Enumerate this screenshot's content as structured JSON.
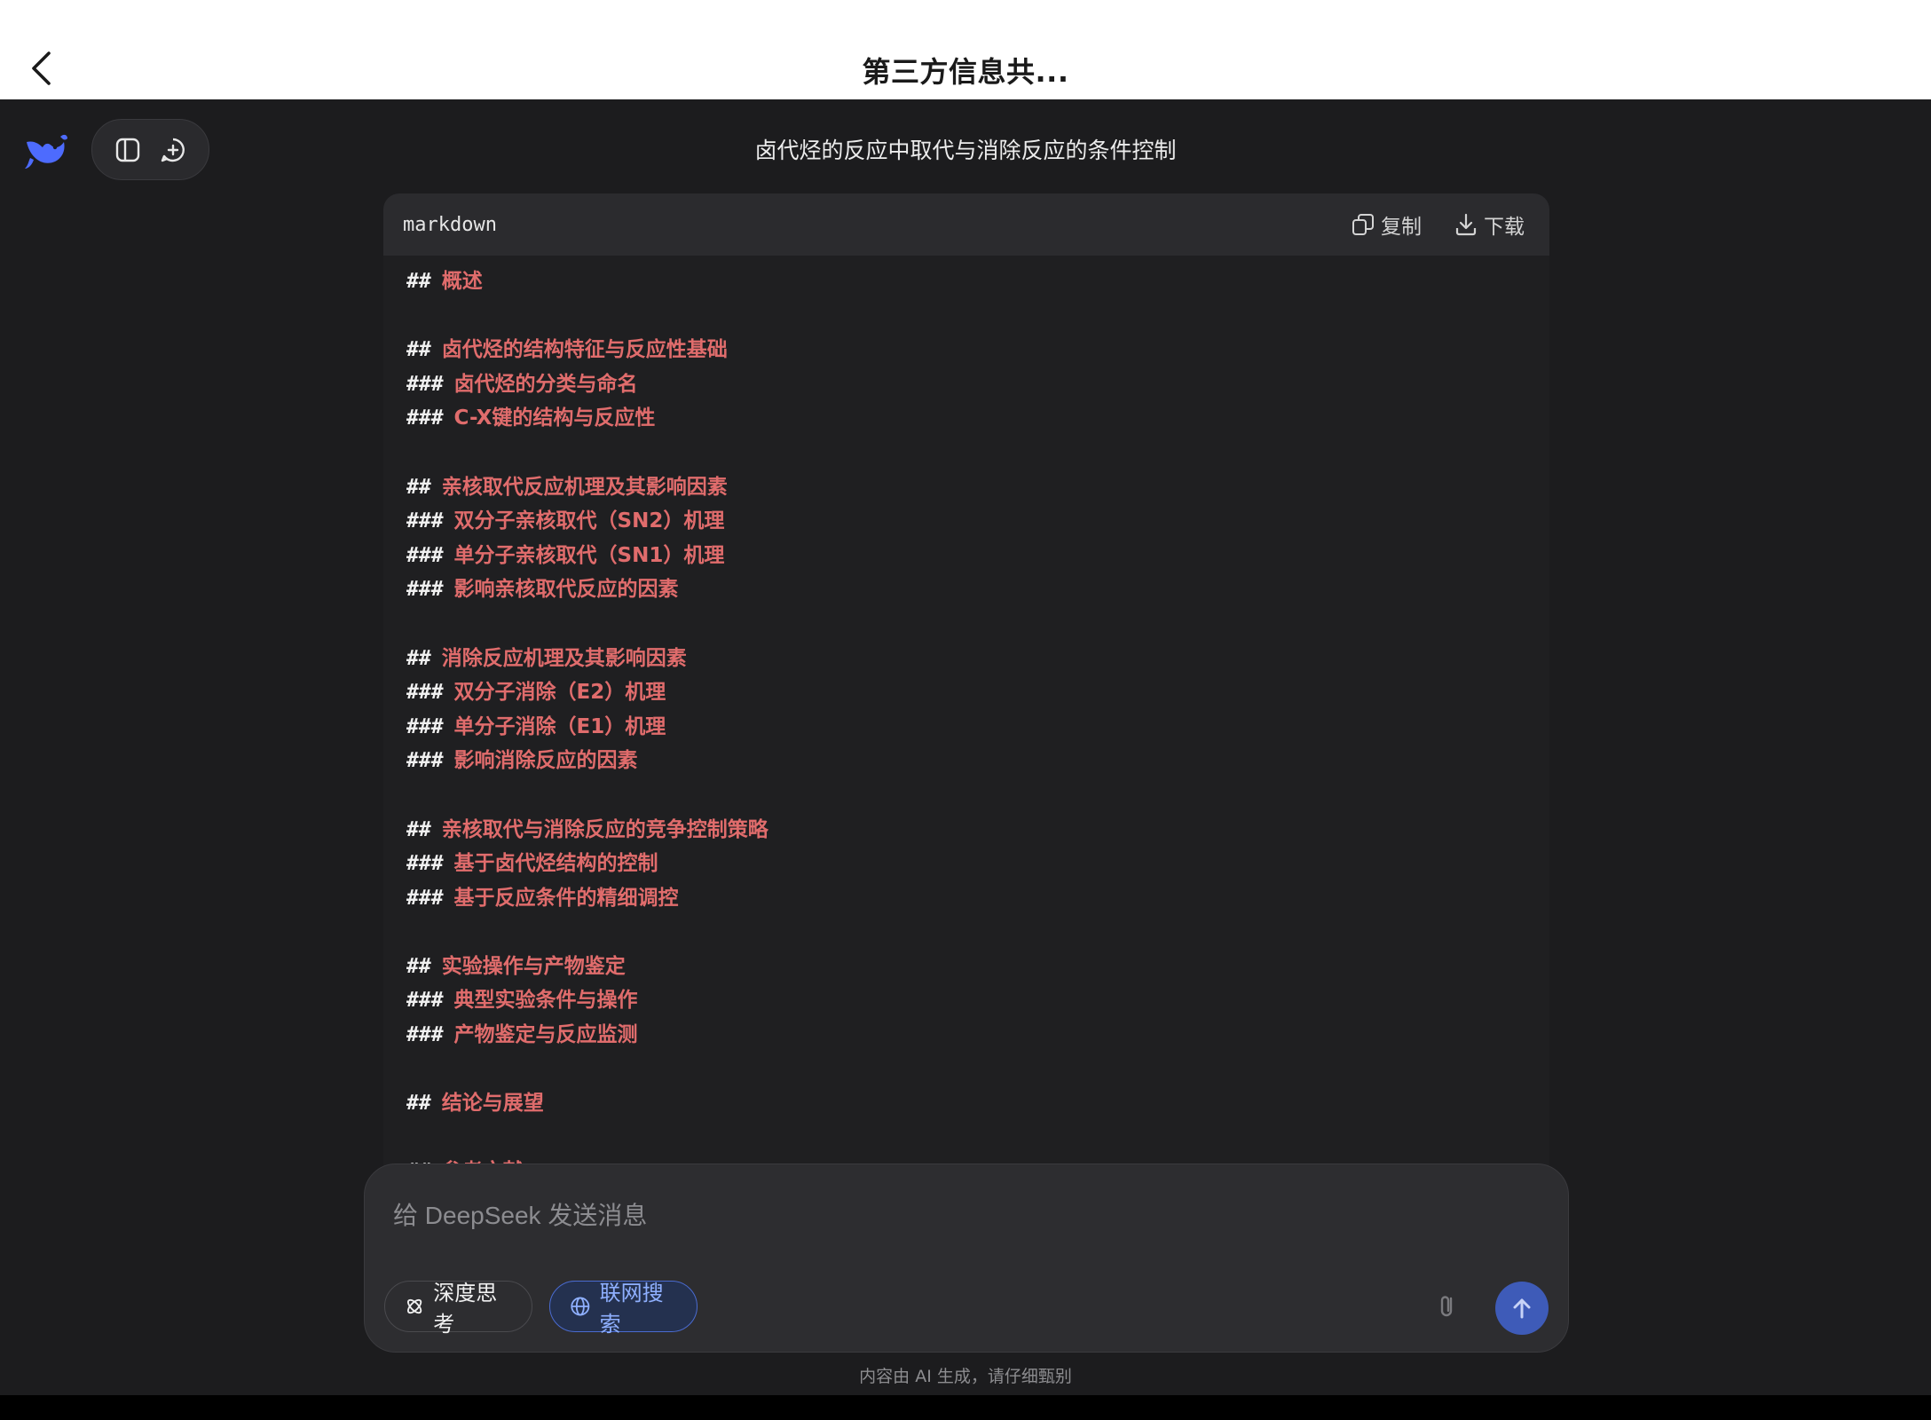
{
  "header": {
    "title": "第三方信息共..."
  },
  "chat": {
    "title": "卤代烃的反应中取代与消除反应的条件控制"
  },
  "code_block": {
    "language": "markdown",
    "copy_label": "复制",
    "download_label": "下载",
    "lines": [
      {
        "hash": "##",
        "text": "概述"
      },
      {
        "hash": "",
        "text": ""
      },
      {
        "hash": "##",
        "text": "卤代烃的结构特征与反应性基础"
      },
      {
        "hash": "###",
        "text": "卤代烃的分类与命名"
      },
      {
        "hash": "###",
        "text": "C-X键的结构与反应性"
      },
      {
        "hash": "",
        "text": ""
      },
      {
        "hash": "##",
        "text": "亲核取代反应机理及其影响因素"
      },
      {
        "hash": "###",
        "text": "双分子亲核取代（SN2）机理"
      },
      {
        "hash": "###",
        "text": "单分子亲核取代（SN1）机理"
      },
      {
        "hash": "###",
        "text": "影响亲核取代反应的因素"
      },
      {
        "hash": "",
        "text": ""
      },
      {
        "hash": "##",
        "text": "消除反应机理及其影响因素"
      },
      {
        "hash": "###",
        "text": "双分子消除（E2）机理"
      },
      {
        "hash": "###",
        "text": "单分子消除（E1）机理"
      },
      {
        "hash": "###",
        "text": "影响消除反应的因素"
      },
      {
        "hash": "",
        "text": ""
      },
      {
        "hash": "##",
        "text": "亲核取代与消除反应的竞争控制策略"
      },
      {
        "hash": "###",
        "text": "基于卤代烃结构的控制"
      },
      {
        "hash": "###",
        "text": "基于反应条件的精细调控"
      },
      {
        "hash": "",
        "text": ""
      },
      {
        "hash": "##",
        "text": "实验操作与产物鉴定"
      },
      {
        "hash": "###",
        "text": "典型实验条件与操作"
      },
      {
        "hash": "###",
        "text": "产物鉴定与反应监测"
      },
      {
        "hash": "",
        "text": ""
      },
      {
        "hash": "##",
        "text": "结论与展望"
      },
      {
        "hash": "",
        "text": ""
      },
      {
        "hash": "##",
        "text": "参考文献"
      }
    ]
  },
  "composer": {
    "placeholder": "给 DeepSeek 发送消息",
    "value": "",
    "deep_think_label": "深度思考",
    "web_search_label": "联网搜索"
  },
  "footer": {
    "disclaimer": "内容由 AI 生成，请仔细甄别"
  },
  "colors": {
    "accent": "#4d6bfe",
    "heading_text": "#e06c6c",
    "background": "#1c1c1e"
  }
}
